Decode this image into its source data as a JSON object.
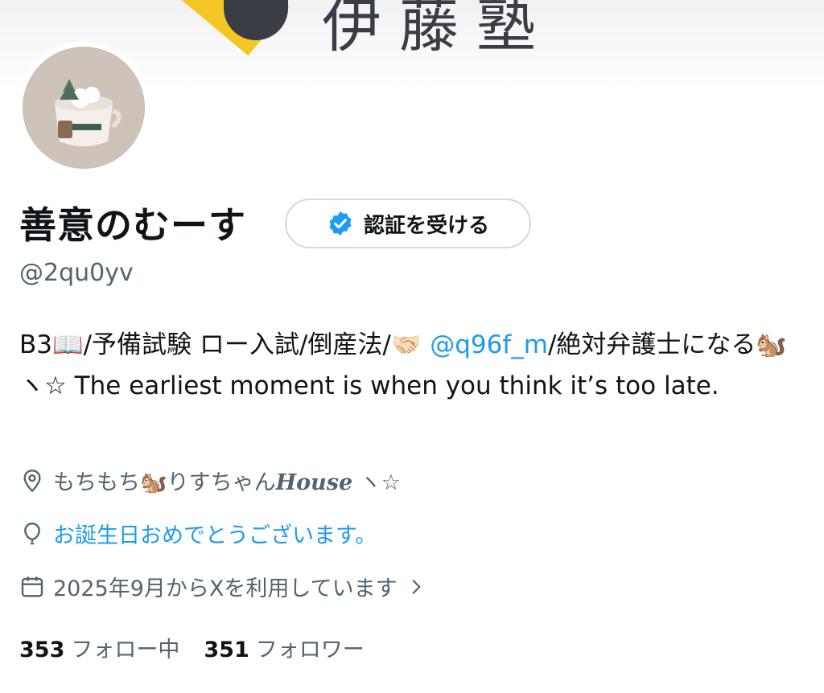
{
  "banner": {
    "text": "伊藤塾"
  },
  "profile": {
    "name": "善意のむーす",
    "handle": "@2qu0yv",
    "verify_button": "認証を受ける",
    "bio": {
      "part1": "B3📖/予備試験 ロー入試/倒産法/🤝🏻 ",
      "mention": "@q96f_m",
      "part2": "/絶対弁護士になる🐿️ ヽ☆ The earliest moment is when you think it’s too late."
    },
    "location": {
      "prefix": "もちもち🐿️りすちゃん",
      "house": "House",
      "suffix": "ヽ☆"
    },
    "birthday": "お誕生日おめでとうございます。",
    "joined": "2025年9月からXを利用しています",
    "following_count": "353",
    "following_label": "フォロー中",
    "followers_count": "351",
    "followers_label": "フォロワー"
  },
  "colors": {
    "accent": "#1d9bf0",
    "muted": "#536471",
    "text": "#0f1419"
  },
  "icons": [
    "location-icon",
    "balloon-icon",
    "calendar-icon",
    "chevron-right-icon",
    "verified-badge-icon"
  ]
}
